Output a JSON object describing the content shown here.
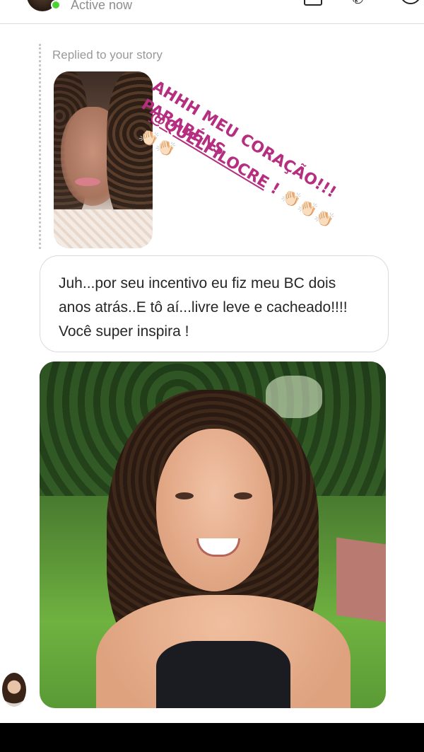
{
  "header": {
    "status": "Active now",
    "icons": [
      "video-camera-icon",
      "phone-icon",
      "info-icon"
    ]
  },
  "story_reply": {
    "label": "Replied to your story",
    "caption_line1": "AHHH MEU CORAÇÃO!!! PARABÉNS",
    "mention": "@QUELFILOCRE",
    "caption_tail": " ! 👏🏻👏🏻👏🏻👏🏻👏🏻"
  },
  "message": {
    "text": "Juh...por seu incentivo eu fiz meu BC dois anos atrás..E tô aí...livre leve e cacheado!!!! Você super inspira !"
  },
  "colors": {
    "caption": "#b52e7f",
    "online": "#4cd137",
    "bubble_border": "#dbdbdb"
  }
}
